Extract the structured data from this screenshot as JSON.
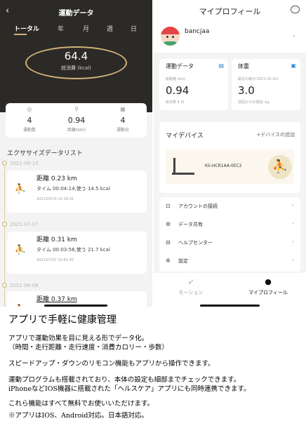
{
  "left_screen": {
    "title": "運動データ",
    "back_icon": "back-chevron-icon",
    "tabs": [
      "トータル",
      "年",
      "月",
      "週",
      "日"
    ],
    "active_tab": "トータル",
    "calories": {
      "value": "64.4",
      "label": "総消費 (kcal)"
    },
    "stats": [
      {
        "icon": "count-icon",
        "value": "4",
        "label": "運動数"
      },
      {
        "icon": "location-pin-icon",
        "value": "0.94",
        "label": "距離(km)"
      },
      {
        "icon": "calendar-icon",
        "value": "4",
        "label": "運動日"
      }
    ],
    "exercise_title": "エクササイズデータリスト",
    "entries": [
      {
        "date": "2021-09-15",
        "distance": "距離 0.23 km",
        "detail": "タイム 00:04:14,使う 14.5 kcal",
        "timestamp": "2021/09/15 15:39:26"
      },
      {
        "date": "2021-07-07",
        "distance": "距離 0.31 km",
        "detail": "タイム 00:03:56,使う 21.7 kcal",
        "timestamp": "2021/07/07 20:42:40"
      },
      {
        "date": "2021-06-08",
        "distance": "距離 0.37 km",
        "detail": "",
        "timestamp": ""
      }
    ]
  },
  "right_screen": {
    "title": "マイプロフィール",
    "chat_icon": "chat-bubble-icon",
    "username": "bancjaa",
    "exercise_card": {
      "title": "運動データ",
      "sub": "総距離 (km)",
      "value": "0.94",
      "note": "総日数 4 日"
    },
    "weight_card": {
      "title": "体重",
      "sub": "最近の様子(2021-05-02)",
      "value": "3.0",
      "note": "前回からの増加--kg"
    },
    "device": {
      "title": "マイデバイス",
      "add": "+デバイスの追加",
      "name": "KS-HCR1AA-0EC2"
    },
    "menu": [
      {
        "icon": "link-icon",
        "label": "アカウントの接続"
      },
      {
        "icon": "share-icon",
        "label": "データ共有"
      },
      {
        "icon": "help-icon",
        "label": "ヘルプセンター"
      },
      {
        "icon": "gear-icon",
        "label": "設定"
      }
    ],
    "nav": [
      {
        "icon": "running-shoe-icon",
        "label": "モーション"
      },
      {
        "icon": "profile-icon",
        "label": "マイプロフィール"
      }
    ],
    "active_nav": "マイプロフィール"
  },
  "description": {
    "heading": "アプリで手軽に健康管理",
    "paragraphs": [
      "アプリで運動効果を目に見える形でデータ化。",
      "（時間・走行距離・走行速度・消費カロリー・歩数）",
      "スピードアップ・ダウンのリモコン機能もアプリから操作できます。",
      "運動プログラムも搭載されており、本体の設定も細部までチェックできます。",
      "iPhoneなどIOS機器に搭載された「ヘルスケア」アプリにも同時連携できます。",
      "これら機能はすべて無料でお使いいただけます。",
      "※アプリはIOS、Android対応。日本語対応。"
    ]
  }
}
